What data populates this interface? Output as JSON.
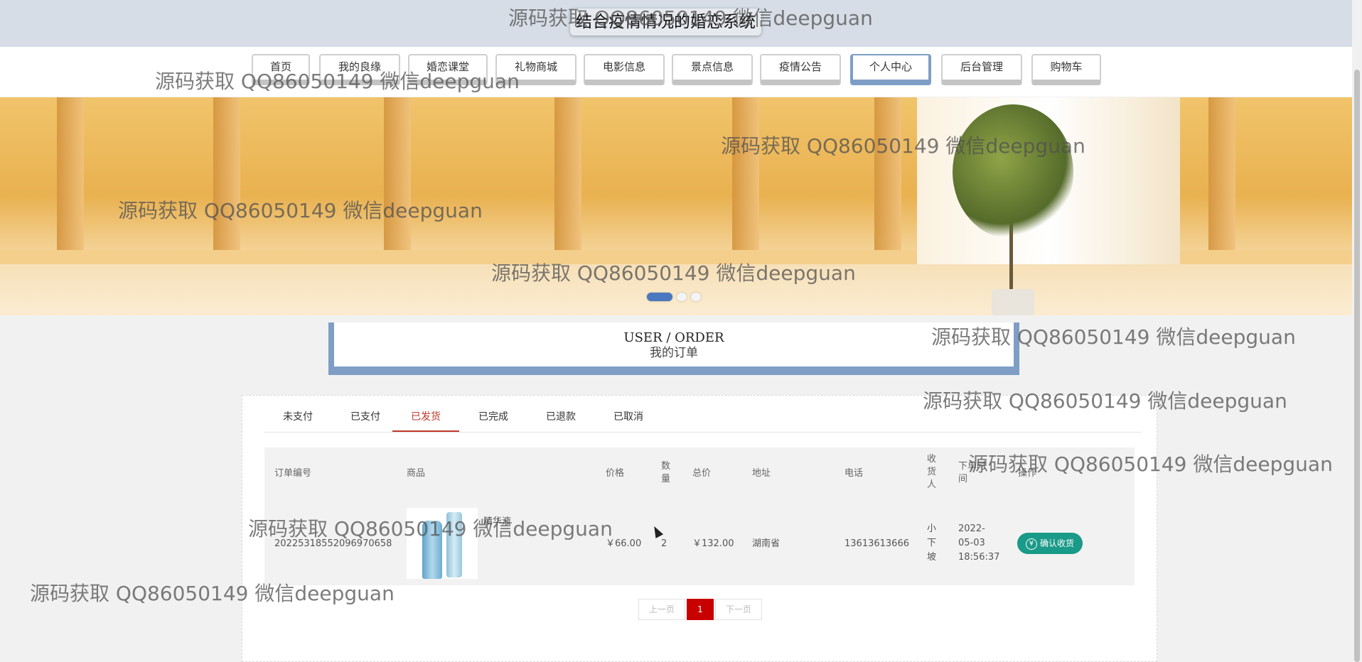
{
  "header": {
    "site_title": "结合疫情情况的婚恋系统"
  },
  "nav": [
    {
      "label": "首页",
      "active": false
    },
    {
      "label": "我的良缘",
      "active": false
    },
    {
      "label": "婚恋课堂",
      "active": false
    },
    {
      "label": "礼物商城",
      "active": false
    },
    {
      "label": "电影信息",
      "active": false
    },
    {
      "label": "景点信息",
      "active": false
    },
    {
      "label": "疫情公告",
      "active": false
    },
    {
      "label": "个人中心",
      "active": true
    },
    {
      "label": "后台管理",
      "active": false
    },
    {
      "label": "购物车",
      "active": false
    }
  ],
  "carousel": {
    "slide_count": 3,
    "active_index": 0
  },
  "section": {
    "title_en": "USER / ORDER",
    "title_cn": "我的订单"
  },
  "tabs": [
    {
      "label": "未支付",
      "active": false
    },
    {
      "label": "已支付",
      "active": false
    },
    {
      "label": "已发货",
      "active": true
    },
    {
      "label": "已完成",
      "active": false
    },
    {
      "label": "已退款",
      "active": false
    },
    {
      "label": "已取消",
      "active": false
    }
  ],
  "table": {
    "headers": {
      "order_no": "订单编号",
      "product": "商品",
      "price": "价格",
      "qty": "数\n量",
      "total": "总价",
      "address": "地址",
      "phone": "电话",
      "receiver": "收\n货\n人",
      "order_time": "下单时\n间",
      "action": "操作"
    },
    "rows": [
      {
        "order_no": "20225318552096970658",
        "product_name": "精华液",
        "price": "￥66.00",
        "qty": "2",
        "total": "￥132.00",
        "address": "湖南省",
        "phone": "13613613666",
        "receiver": "小\n下\n坡",
        "order_time": "2022-\n05-03\n18:56:37",
        "action_label": "确认收货",
        "action_icon": "yen-icon"
      }
    ]
  },
  "pagination": {
    "prev": "上一页",
    "current": "1",
    "next": "下一页"
  },
  "watermark": "源码获取 QQ86050149 微信deepguan",
  "colors": {
    "accent": "#7e9ec6",
    "active_tab": "#c0392b",
    "confirm": "#1a9a88",
    "page_current": "#c80000"
  }
}
